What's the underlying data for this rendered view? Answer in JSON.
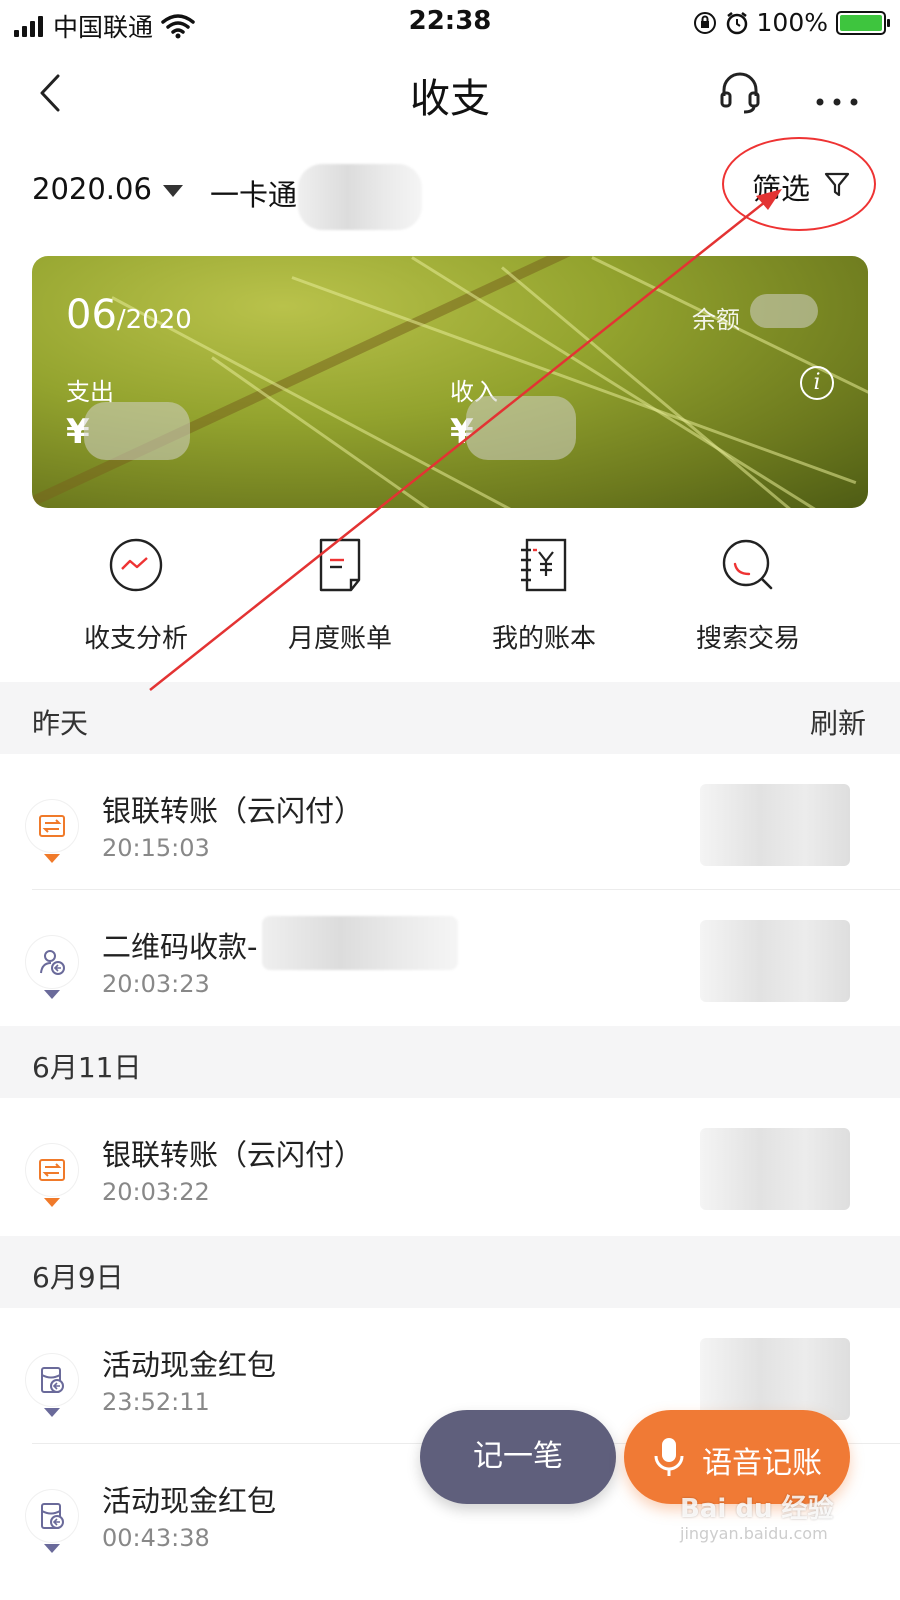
{
  "status_bar": {
    "carrier": "中国联通",
    "time": "22:38",
    "battery": "100%"
  },
  "nav": {
    "title": "收支",
    "back_icon": "chevron-left-icon",
    "service_icon": "headset-icon",
    "more_icon": "more-dots-icon"
  },
  "filter_row": {
    "month": "2020.06",
    "account": "一卡通",
    "filter_label": "筛选"
  },
  "card": {
    "month": "06",
    "year": "/2020",
    "balance_label": "余额",
    "expense_label": "支出",
    "income_label": "收入",
    "currency": "¥",
    "info": "i"
  },
  "quick_actions": [
    {
      "label": "收支分析",
      "icon": "chart-icon"
    },
    {
      "label": "月度账单",
      "icon": "bill-icon"
    },
    {
      "label": "我的账本",
      "icon": "ledger-icon"
    },
    {
      "label": "搜索交易",
      "icon": "search-icon"
    }
  ],
  "sections": [
    {
      "title": "昨天",
      "action": "刷新",
      "items": [
        {
          "title": "银联转账（云闪付）",
          "time": "20:15:03",
          "icon": "transfer-icon",
          "tone": "orange"
        },
        {
          "title": "二维码收款-",
          "time": "20:03:23",
          "icon": "person-receive-icon",
          "tone": "purple"
        }
      ]
    },
    {
      "title": "6月11日",
      "items": [
        {
          "title": "银联转账（云闪付）",
          "time": "20:03:22",
          "icon": "transfer-icon",
          "tone": "orange"
        }
      ]
    },
    {
      "title": "6月9日",
      "items": [
        {
          "title": "活动现金红包",
          "time": "23:52:11",
          "icon": "red-packet-icon",
          "tone": "purple"
        },
        {
          "title": "活动现金红包",
          "time": "00:43:38",
          "icon": "red-packet-icon",
          "tone": "purple"
        }
      ]
    }
  ],
  "fab": {
    "note": "记一笔",
    "voice": "语音记账"
  },
  "watermark": {
    "brand": "Bai du 经验",
    "url": "jingyan.baidu.com"
  },
  "colors": {
    "accent_orange": "#f07a35",
    "accent_purple": "#5f5f7c",
    "annotation_red": "#e33333"
  }
}
